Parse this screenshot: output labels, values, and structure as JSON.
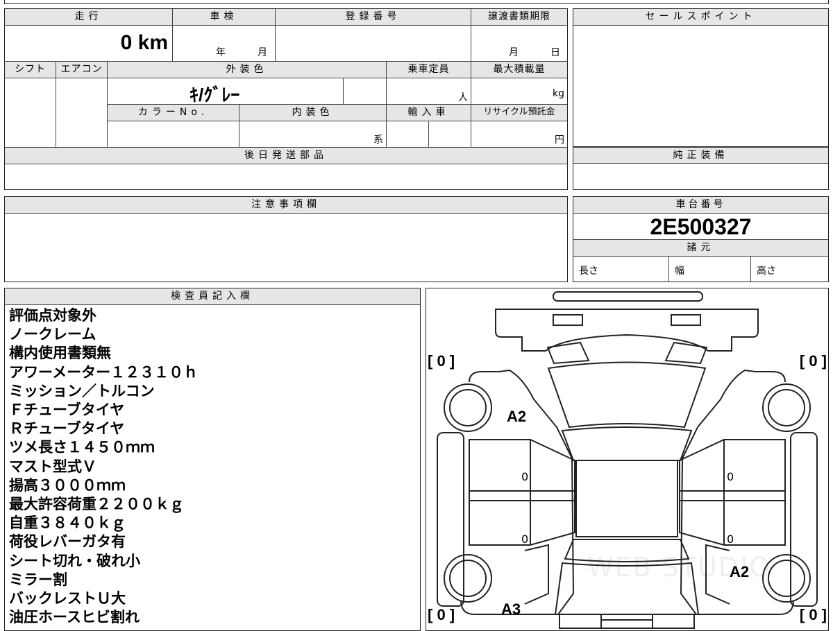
{
  "sheet": {
    "headers": {
      "mileage": "走行",
      "inspection": "車検",
      "registration_no": "登録番号",
      "transfer_deadline": "譲渡書類期限",
      "sale_points": "セールスポイント",
      "shift": "シフト",
      "aircon": "エアコン",
      "exterior_color": "外装色",
      "capacity": "乗車定員",
      "max_load": "最大積載量",
      "color_no": "カラーNo.",
      "interior_color": "内装色",
      "import": "輸入車",
      "recycle_fee": "リサイクル預託金",
      "later_parts": "後日発送部品",
      "genuine_equipment": "純正装備",
      "caution": "注意事項欄",
      "chassis_no": "車台番号",
      "specs": "諸元",
      "inspector": "検査員記入欄"
    },
    "values": {
      "mileage": "0 km",
      "year_unit": "年",
      "month_unit": "月",
      "deadline_month": "月",
      "deadline_day": "日",
      "exterior_color": "ｷ/ｸﾞﾚｰ",
      "person_unit": "人",
      "kg_unit": "kg",
      "interior_suffix": "系",
      "yen_unit": "円",
      "chassis_no": "2E500327",
      "length": "長さ",
      "width": "幅",
      "height": "高さ"
    },
    "inspector_notes": [
      "評価点対象外",
      "ノークレーム",
      "構内使用書類無",
      "アワーメーター１２３１０ｈ",
      "ミッション／トルコン",
      "Ｆチューブタイヤ",
      "Ｒチューブタイヤ",
      "ツメ長さ１４５０ｍｍ",
      "マスト型式Ｖ",
      "揚高３０００ｍｍ",
      "最大許容荷重２２００ｋｇ",
      "自重３８４０ｋｇ",
      "荷役レバーガタ有",
      "シート切れ・破れ小",
      "ミラー割",
      "バックレストＵ大",
      "油圧ホースヒビ割れ"
    ]
  },
  "diagram": {
    "tire_fl": "[ 0 ]",
    "tire_fr": "[ 0 ]",
    "tire_rl": "[ 0 ]",
    "tire_rr": "[ 0 ]",
    "mark_a2_front_left": "A2",
    "mark_a2_rear_right": "A2",
    "mark_a3_rear_left": "A3",
    "door_fl": "0",
    "door_rl": "0",
    "door_fr": "0",
    "door_rr": "0",
    "watermark": "WEB STUDIO"
  }
}
